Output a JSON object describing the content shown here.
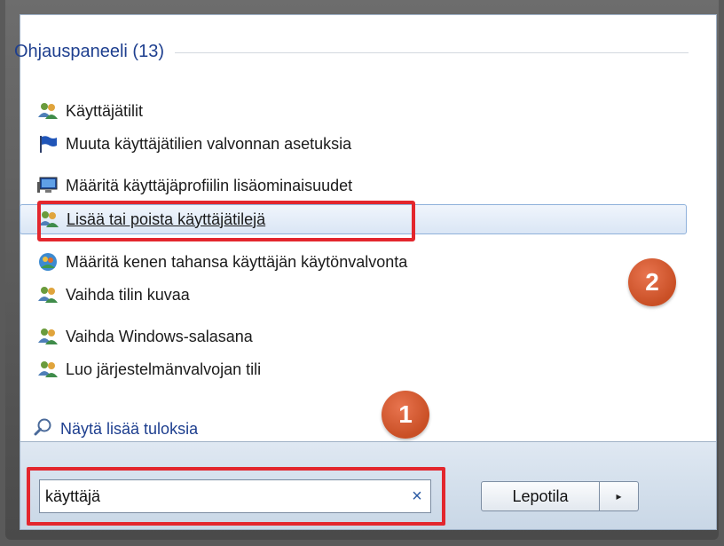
{
  "section": {
    "title": "Ohjauspaneeli (13)"
  },
  "results": [
    {
      "label": "Käyttäjätilit",
      "icon": "users-icon"
    },
    {
      "label": "Muuta käyttäjätilien valvonnan asetuksia",
      "icon": "flag-icon"
    },
    {
      "label": "Määritä käyttäjäprofiilin lisäominaisuudet",
      "icon": "computer-icon"
    },
    {
      "label": "Lisää tai poista käyttäjätilejä",
      "icon": "users-icon"
    },
    {
      "label": "Määritä kenen tahansa käyttäjän käytönvalvonta",
      "icon": "family-safety-icon"
    },
    {
      "label": "Vaihda tilin kuvaa",
      "icon": "users-icon"
    },
    {
      "label": "Vaihda Windows-salasana",
      "icon": "users-icon"
    },
    {
      "label": "Luo järjestelmänvalvojan tili",
      "icon": "users-icon"
    }
  ],
  "more_results": {
    "label": "Näytä lisää tuloksia"
  },
  "search": {
    "value": "käyttäjä",
    "clear_symbol": "×"
  },
  "shutdown": {
    "label": "Lepotila",
    "arrow": "▸"
  },
  "badges": {
    "one": "1",
    "two": "2"
  },
  "colors": {
    "link": "#1e3f8f",
    "annotation_red": "#e3262d",
    "badge_orange": "#d4592c"
  }
}
